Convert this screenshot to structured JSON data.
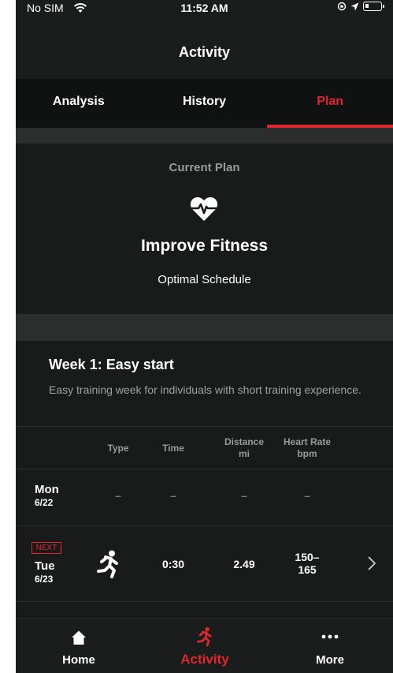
{
  "status_bar": {
    "carrier": "No SIM",
    "time": "11:52 AM"
  },
  "header": {
    "title": "Activity"
  },
  "tabs": [
    {
      "label": "Analysis",
      "active": false
    },
    {
      "label": "History",
      "active": false
    },
    {
      "label": "Plan",
      "active": true
    }
  ],
  "plan": {
    "section_label": "Current Plan",
    "icon": "heart-pulse-icon",
    "name": "Improve Fitness",
    "schedule": "Optimal Schedule"
  },
  "week": {
    "title": "Week 1: Easy start",
    "description": "Easy training week for individuals with short training experience."
  },
  "table": {
    "headers": {
      "type": "Type",
      "time": "Time",
      "distance": "Distance",
      "distance_unit": "mi",
      "heart_rate": "Heart Rate",
      "heart_rate_unit": "bpm"
    },
    "rows": [
      {
        "day": "Mon",
        "date": "6/22",
        "badge": "",
        "type": "–",
        "time": "–",
        "distance": "–",
        "heart_rate": "–"
      },
      {
        "day": "Tue",
        "date": "6/23",
        "badge": "NEXT",
        "type": "running-icon",
        "time": "0:30",
        "distance": "2.49",
        "heart_rate_low": "150–",
        "heart_rate_high": "165"
      }
    ]
  },
  "bottom_nav": [
    {
      "label": "Home",
      "icon": "home-icon",
      "active": false
    },
    {
      "label": "Activity",
      "icon": "running-icon",
      "active": true
    },
    {
      "label": "More",
      "icon": "more-dots-icon",
      "active": false
    }
  ],
  "colors": {
    "accent": "#e0262f",
    "background": "#191a1a",
    "secondary_text": "#9a9a9a"
  }
}
